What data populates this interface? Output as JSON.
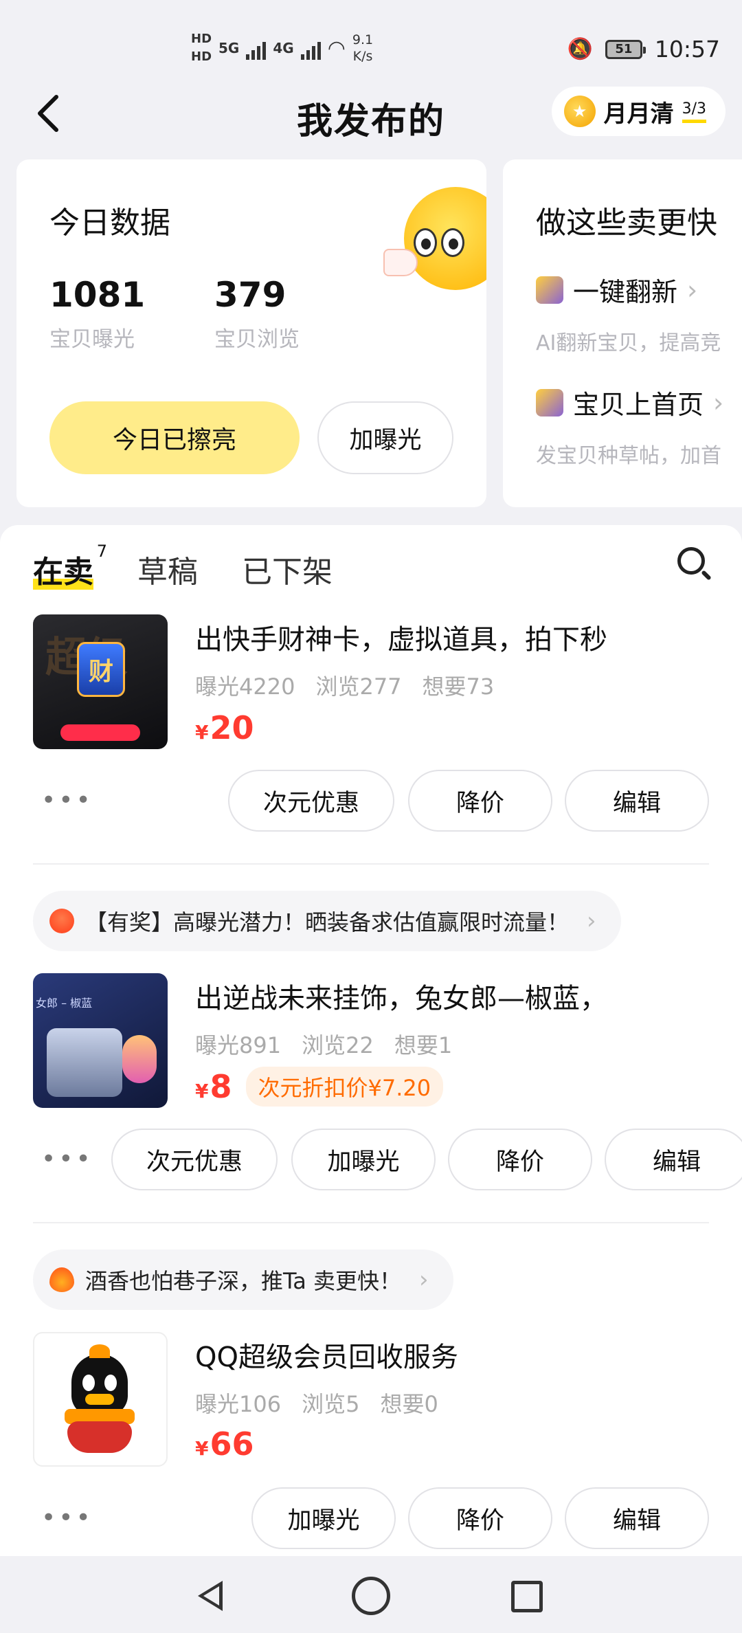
{
  "status_bar": {
    "hd1": "HD",
    "hd2": "HD",
    "net1": "5G",
    "net2": "4G",
    "speed_value": "9.1",
    "speed_unit": "K/s",
    "battery": "51",
    "time": "10:57"
  },
  "header": {
    "title": "我发布的",
    "moon_label": "月月清",
    "moon_count": "3/3"
  },
  "today": {
    "title": "今日数据",
    "exposure_value": "1081",
    "exposure_label": "宝贝曝光",
    "views_value": "379",
    "views_label": "宝贝浏览",
    "polished_button": "今日已擦亮",
    "boost_button": "加曝光"
  },
  "tips": {
    "title": "做这些卖更快",
    "item1_label": "一键翻新",
    "item1_desc": "AI翻新宝贝，提高竞",
    "item2_label": "宝贝上首页",
    "item2_desc": "发宝贝种草帖，加首"
  },
  "tabs": {
    "on_sale": "在卖",
    "on_sale_count": "7",
    "drafts": "草稿",
    "off_shelf": "已下架"
  },
  "items": [
    {
      "title": "出快手财神卡，虚拟道具，拍下秒",
      "exposure": "曝光4220",
      "views": "浏览277",
      "wants": "想要73",
      "currency": "¥",
      "price": "20",
      "more": "•••",
      "btn1": "次元优惠",
      "btn2": "降价",
      "btn3": "编辑"
    },
    {
      "promo": "【有奖】高曝光潜力！晒装备求估值赢限时流量！",
      "title": "出逆战未来挂饰，兔女郎—椒蓝，",
      "exposure": "曝光891",
      "views": "浏览22",
      "wants": "想要1",
      "currency": "¥",
      "price": "8",
      "discount": "次元折扣价¥7.20",
      "more": "•••",
      "btn1": "次元优惠",
      "btn2": "加曝光",
      "btn3": "降价",
      "btn4": "编辑"
    },
    {
      "promo": "酒香也怕巷子深，推Ta 卖更快！",
      "title": "QQ超级会员回收服务",
      "exposure": "曝光106",
      "views": "浏览5",
      "wants": "想要0",
      "currency": "¥",
      "price": "66",
      "more": "•••",
      "btn1": "加曝光",
      "btn2": "降价",
      "btn3": "编辑"
    }
  ],
  "thumb_text": {
    "item1_big": "超级",
    "item1_badge": "财",
    "item2_tag": "女郎 – 椒蓝"
  },
  "colors": {
    "accent_yellow": "#ffec8a",
    "highlight_yellow": "#ffe21a",
    "price_red": "#ff3b30",
    "discount_orange": "#ff6b00"
  }
}
